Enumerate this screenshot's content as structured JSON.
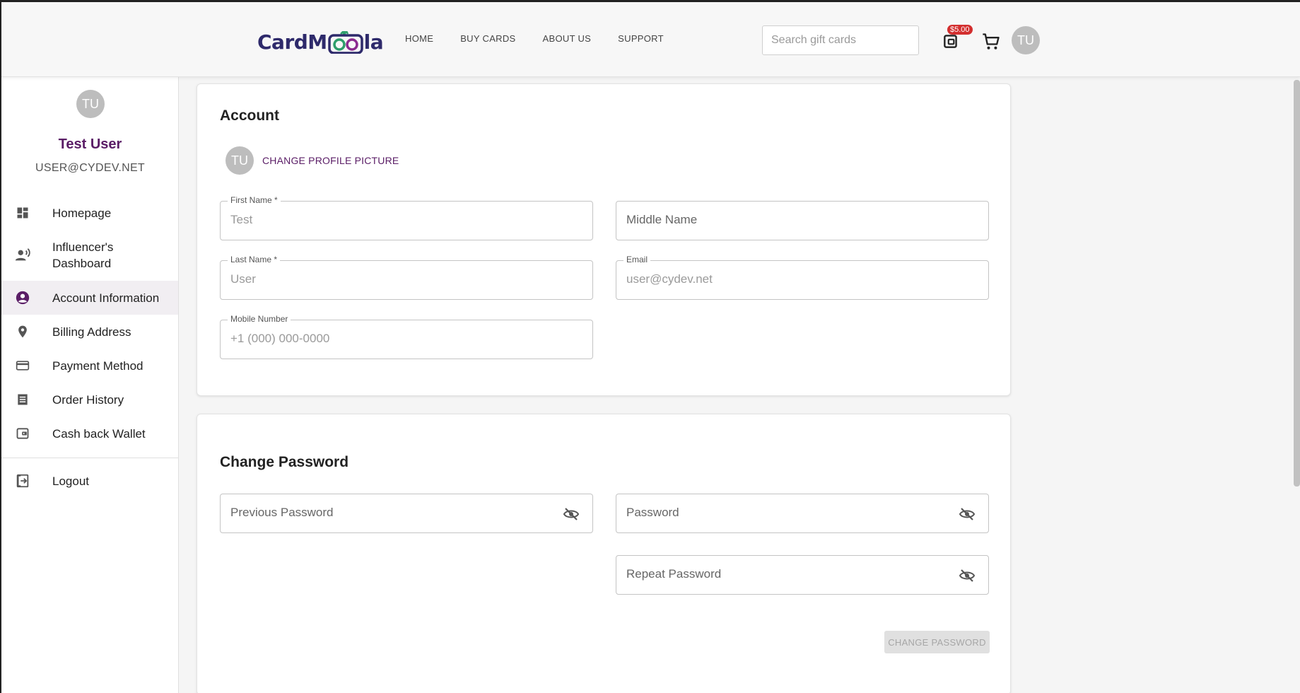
{
  "header": {
    "logo_text_left": "CardM",
    "logo_text_right": "la",
    "nav": [
      "HOME",
      "BUY CARDS",
      "ABOUT US",
      "SUPPORT"
    ],
    "search_placeholder": "Search gift cards",
    "wallet_badge": "$5.00",
    "avatar_initials": "TU",
    "colors": {
      "brand": "#5a1d66",
      "badge": "#d32f2f",
      "logo_text": "#2e2a6b"
    }
  },
  "sidebar": {
    "avatar_initials": "TU",
    "user_name": "Test User",
    "user_email": "USER@CYDEV.NET",
    "items": [
      {
        "label": "Homepage",
        "icon": "dashboard-icon"
      },
      {
        "label": "Influencer's Dashboard",
        "icon": "record-voice-icon"
      },
      {
        "label": "Account Information",
        "icon": "account-circle-icon",
        "active": true
      },
      {
        "label": "Billing Address",
        "icon": "location-pin-icon"
      },
      {
        "label": "Payment Method",
        "icon": "credit-card-icon"
      },
      {
        "label": "Order History",
        "icon": "receipt-icon"
      },
      {
        "label": "Cash back Wallet",
        "icon": "wallet-icon"
      }
    ],
    "logout_label": "Logout"
  },
  "account": {
    "title": "Account",
    "avatar_initials": "TU",
    "change_picture_label": "CHANGE PROFILE PICTURE",
    "first_name_label": "First Name *",
    "first_name_value": "Test",
    "middle_name_placeholder": "Middle Name",
    "last_name_label": "Last Name *",
    "last_name_value": "User",
    "email_label": "Email",
    "email_value": "user@cydev.net",
    "mobile_label": "Mobile Number",
    "mobile_value": "+1 (000) 000-0000"
  },
  "password": {
    "title": "Change Password",
    "previous_placeholder": "Previous Password",
    "password_placeholder": "Password",
    "repeat_placeholder": "Repeat Password",
    "submit_label": "CHANGE PASSWORD"
  }
}
